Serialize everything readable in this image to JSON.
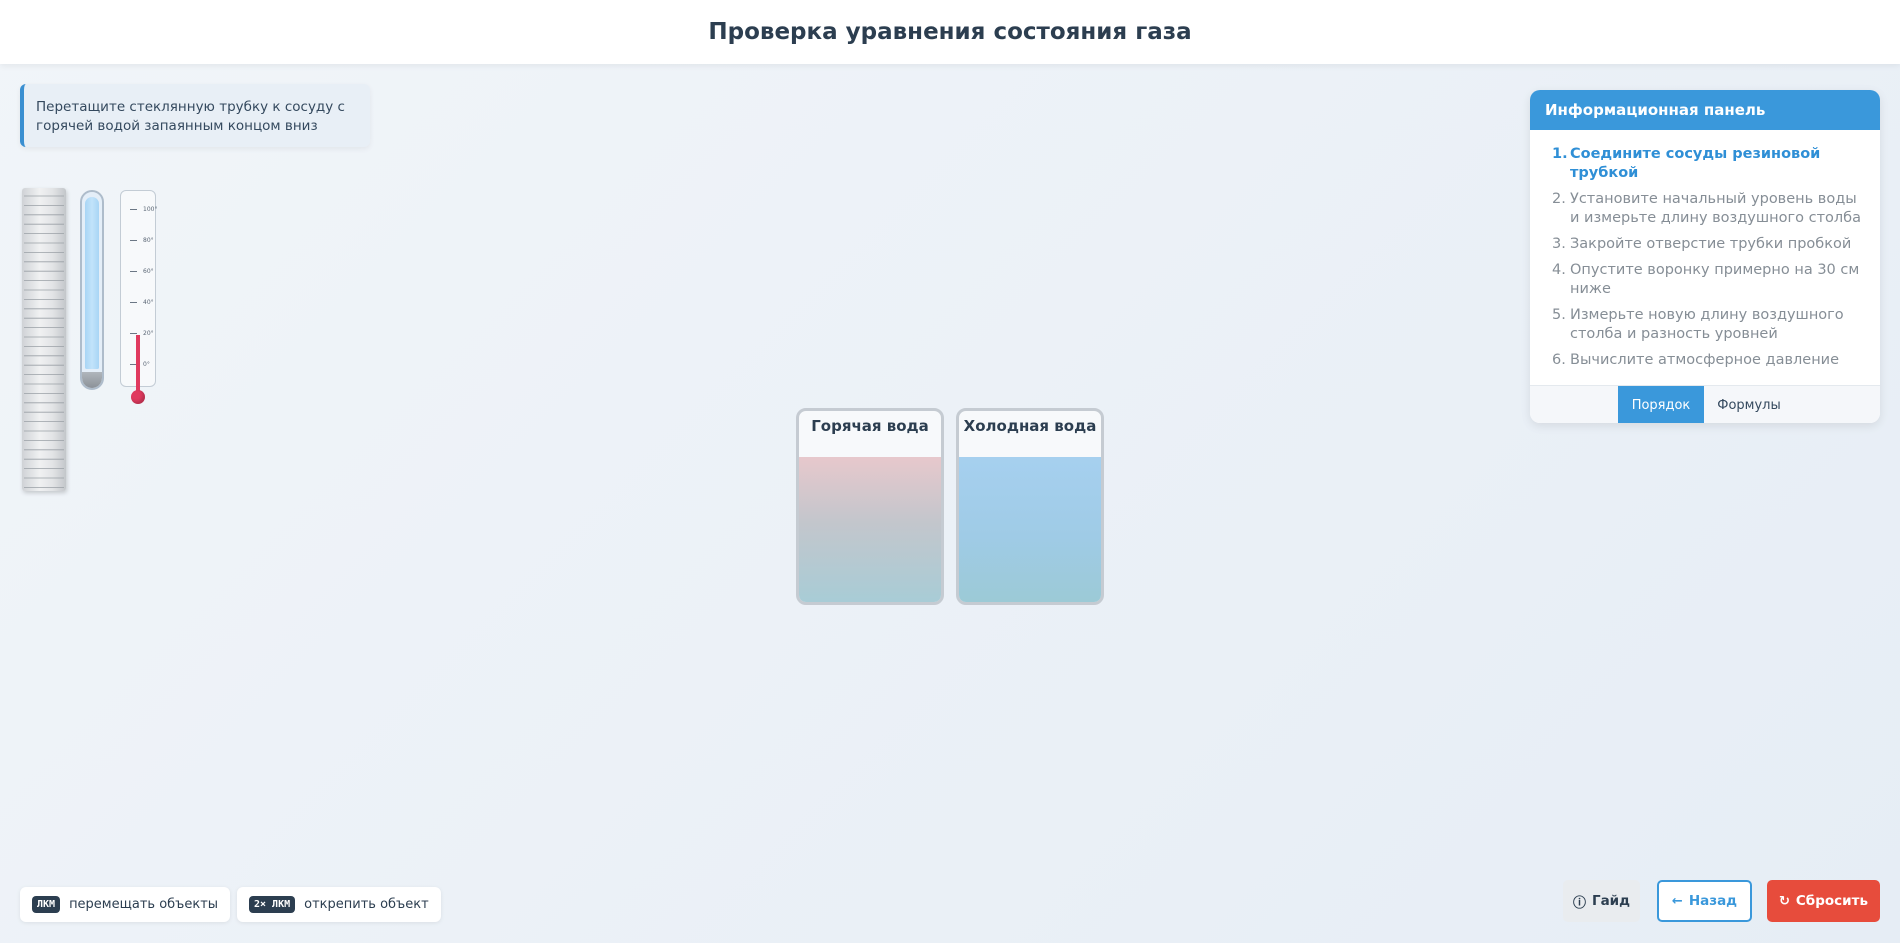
{
  "header": {
    "title": "Проверка уравнения состояния газа"
  },
  "hint": {
    "text": "Перетащите стеклянную трубку к сосуду с горячей водой запаянным концом вниз"
  },
  "thermometer": {
    "scale": [
      "100°",
      "80°",
      "60°",
      "40°",
      "20°",
      "0°"
    ]
  },
  "vessels": {
    "hot": "Горячая вода",
    "cold": "Холодная вода"
  },
  "panel": {
    "title": "Информационная панель",
    "steps": [
      {
        "num": "1.",
        "text": "Соедините сосуды резиновой трубкой"
      },
      {
        "num": "2.",
        "text": "Установите начальный уровень воды и измерьте длину воздушного столба"
      },
      {
        "num": "3.",
        "text": "Закройте отверстие трубки пробкой"
      },
      {
        "num": "4.",
        "text": "Опустите воронку примерно на 30 см ниже"
      },
      {
        "num": "5.",
        "text": "Измерьте новую длину воздушного столба и разность уровней"
      },
      {
        "num": "6.",
        "text": "Вычислите атмосферное давление"
      }
    ],
    "tabs": {
      "order": "Порядок",
      "formulas": "Формулы"
    }
  },
  "legend": {
    "move_key": "ЛКМ",
    "move_text": "перемещать объекты",
    "detach_key": "2× ЛКМ",
    "detach_text": "открепить объект"
  },
  "buttons": {
    "guide": "Гайд",
    "back": "Назад",
    "reset": "Сбросить"
  },
  "colors": {
    "accent": "#3a98db",
    "reset": "#e74c3c",
    "thermometer_fluid": "#e03a5f"
  }
}
